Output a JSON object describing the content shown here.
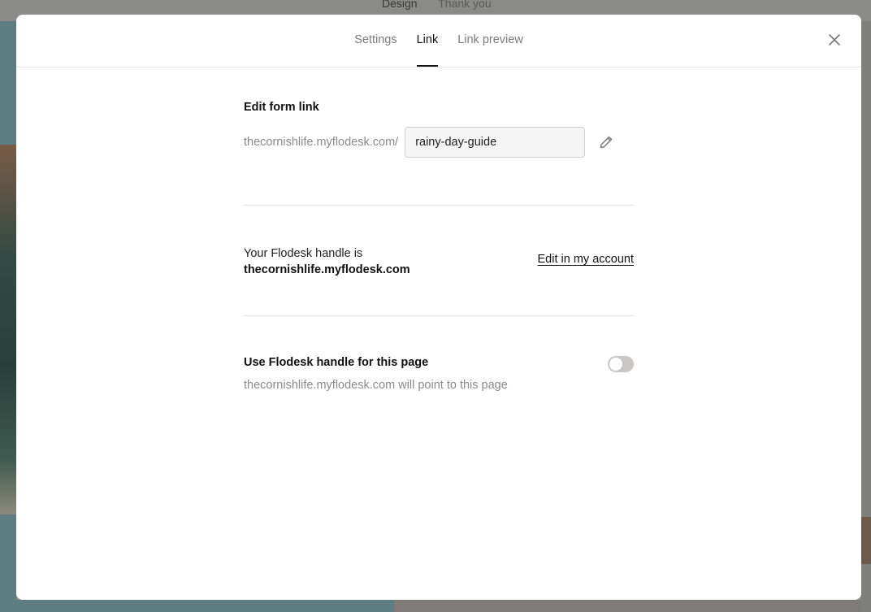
{
  "background": {
    "tabs": [
      "Design",
      "Thank you"
    ]
  },
  "modal": {
    "tabs": [
      {
        "label": "Settings",
        "active": false
      },
      {
        "label": "Link",
        "active": true
      },
      {
        "label": "Link preview",
        "active": false
      }
    ],
    "close_icon": "close-icon"
  },
  "edit_link": {
    "title": "Edit form link",
    "domain_prefix": "thecornishlife.myflodesk.com/",
    "slug_value": "rainy-day-guide",
    "edit_icon": "pencil-icon"
  },
  "handle": {
    "line1": "Your Flodesk handle is",
    "handle_value": "thecornishlife.myflodesk.com",
    "edit_account_label": "Edit in my account"
  },
  "use_handle": {
    "title": "Use Flodesk handle for this page",
    "subtitle": "thecornishlife.myflodesk.com will point to this page",
    "toggle_on": false
  }
}
